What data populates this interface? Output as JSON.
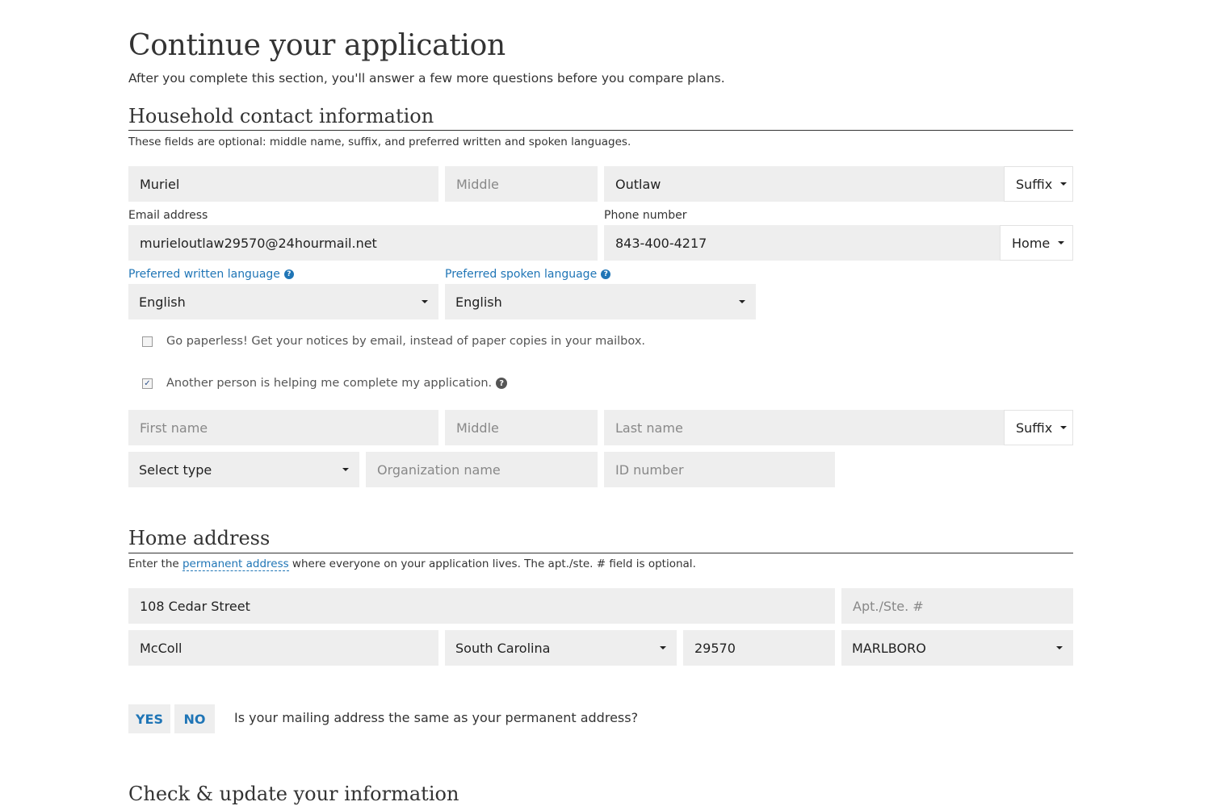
{
  "page": {
    "title": "Continue your application",
    "lead": "After you complete this section, you'll answer a few more questions before you compare plans."
  },
  "contact": {
    "heading": "Household contact information",
    "note": "These fields are optional: middle name, suffix, and preferred written and spoken languages.",
    "first_name": "Muriel",
    "middle_placeholder": "Middle",
    "last_name": "Outlaw",
    "suffix_label": "Suffix",
    "email_label": "Email address",
    "email": "murieloutlaw29570@24hourmail.net",
    "phone_label": "Phone number",
    "phone": "843-400-4217",
    "phone_type": "Home",
    "written_lang_label": "Preferred written language",
    "written_lang": "English",
    "spoken_lang_label": "Preferred spoken language",
    "spoken_lang": "English",
    "paperless_text": "Go paperless! Get your notices by email, instead of paper copies in your mailbox.",
    "paperless_checked": false,
    "helper_text": "Another person is helping me complete my application.",
    "helper_checked": true
  },
  "helper": {
    "first_placeholder": "First name",
    "middle_placeholder": "Middle",
    "last_placeholder": "Last name",
    "suffix_label": "Suffix",
    "type_label": "Select type",
    "org_placeholder": "Organization name",
    "id_placeholder": "ID number"
  },
  "address": {
    "heading": "Home address",
    "note_before": "Enter the ",
    "note_link": "permanent address",
    "note_after": " where everyone on your application lives. The apt./ste. # field is optional.",
    "street": "108 Cedar Street",
    "apt_placeholder": "Apt./Ste. #",
    "city": "McColl",
    "state": "South Carolina",
    "zip": "29570",
    "county": "MARLBORO"
  },
  "mailing": {
    "yes": "YES",
    "no": "NO",
    "question": "Is your mailing address the same as your permanent address?"
  },
  "next_section": {
    "heading": "Check & update your information"
  },
  "colors": {
    "link": "#1f75b6",
    "field_bg": "#eeeeee",
    "text": "#333333"
  }
}
